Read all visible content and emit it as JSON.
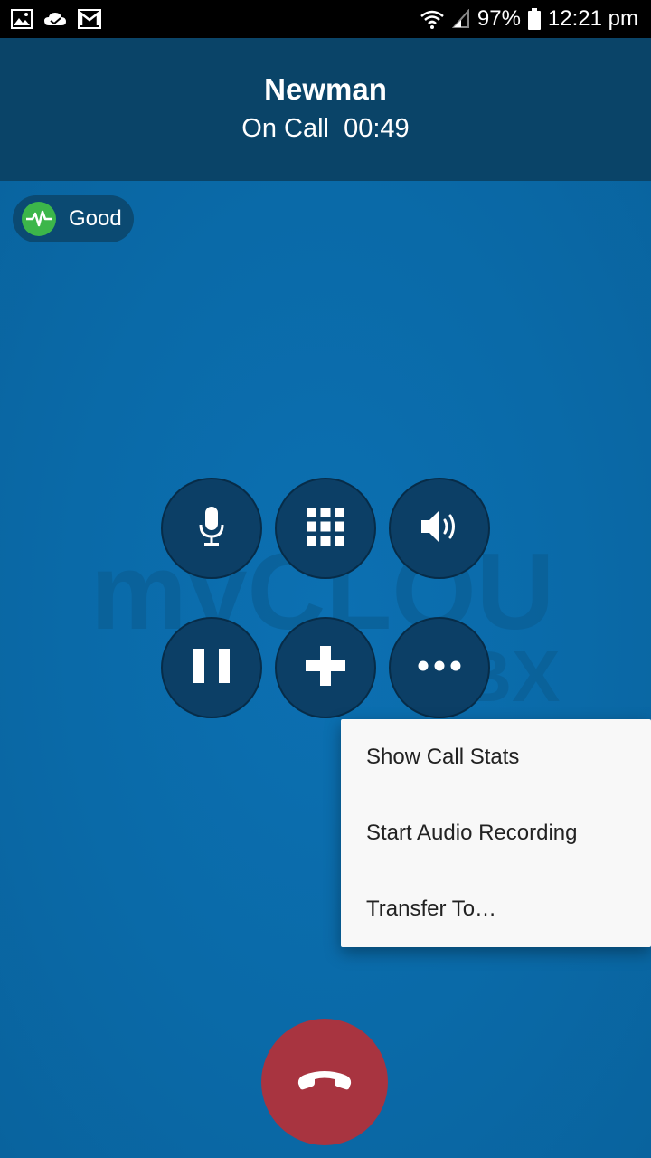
{
  "status_bar": {
    "battery": "97%",
    "time": "12:21 pm",
    "icons": [
      "image-icon",
      "cloud-icon",
      "gmail-icon",
      "wifi-icon",
      "signal-icon",
      "battery-icon"
    ]
  },
  "call": {
    "name": "Newman",
    "status": "On Call  00:49"
  },
  "quality": {
    "label": "Good",
    "icon": "pulse-icon",
    "color": "#3cb64a"
  },
  "watermark": {
    "line1": "myCLOUD",
    "line2": "PBX"
  },
  "controls": [
    {
      "name": "mute-button",
      "icon": "microphone-icon"
    },
    {
      "name": "keypad-button",
      "icon": "dialpad-icon"
    },
    {
      "name": "speaker-button",
      "icon": "speaker-icon"
    },
    {
      "name": "hold-button",
      "icon": "pause-icon"
    },
    {
      "name": "add-call-button",
      "icon": "plus-icon"
    },
    {
      "name": "more-button",
      "icon": "more-dots-icon"
    }
  ],
  "menu": {
    "items": [
      "Show Call Stats",
      "Start Audio Recording",
      "Transfer To…"
    ]
  },
  "end_call": {
    "icon": "hang-up-icon",
    "color": "#a83440"
  },
  "colors": {
    "header": "#0a4468",
    "background": "#0a6aa8",
    "button": "#0c3f66"
  }
}
